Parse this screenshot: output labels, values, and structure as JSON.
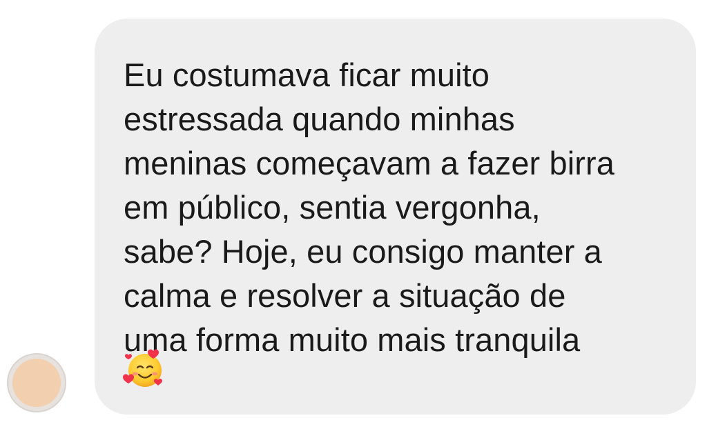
{
  "message": {
    "text": "Eu costumava ficar muito\nestressada quando minhas\nmeninas começavam a fazer birra\nem público, sentia vergonha,\nsabe? Hoje, eu consigo manter a\ncalma e resolver a situação de\numa forma muito mais tranquila",
    "emoji": "smiling-face-with-hearts-icon"
  },
  "colors": {
    "bubble": "#eeeeef",
    "text": "#1a1a1a",
    "avatar_blur": "#f2cfae"
  }
}
